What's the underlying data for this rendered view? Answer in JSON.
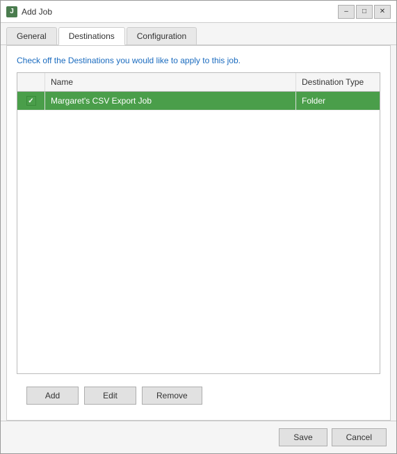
{
  "window": {
    "title": "Add Job",
    "icon": "J"
  },
  "title_controls": {
    "minimize": "–",
    "maximize": "□",
    "close": "✕"
  },
  "tabs": [
    {
      "id": "general",
      "label": "General",
      "active": false
    },
    {
      "id": "destinations",
      "label": "Destinations",
      "active": true
    },
    {
      "id": "configuration",
      "label": "Configuration",
      "active": false
    }
  ],
  "info_text": "Check off the Destinations you would like to apply to this job.",
  "table": {
    "columns": [
      {
        "id": "check",
        "label": ""
      },
      {
        "id": "name",
        "label": "Name"
      },
      {
        "id": "dest_type",
        "label": "Destination Type"
      }
    ],
    "rows": [
      {
        "checked": true,
        "name": "Margaret's CSV Export Job",
        "dest_type": "Folder",
        "selected": true
      }
    ]
  },
  "buttons": {
    "add": "Add",
    "edit": "Edit",
    "remove": "Remove"
  },
  "footer": {
    "save": "Save",
    "cancel": "Cancel"
  }
}
